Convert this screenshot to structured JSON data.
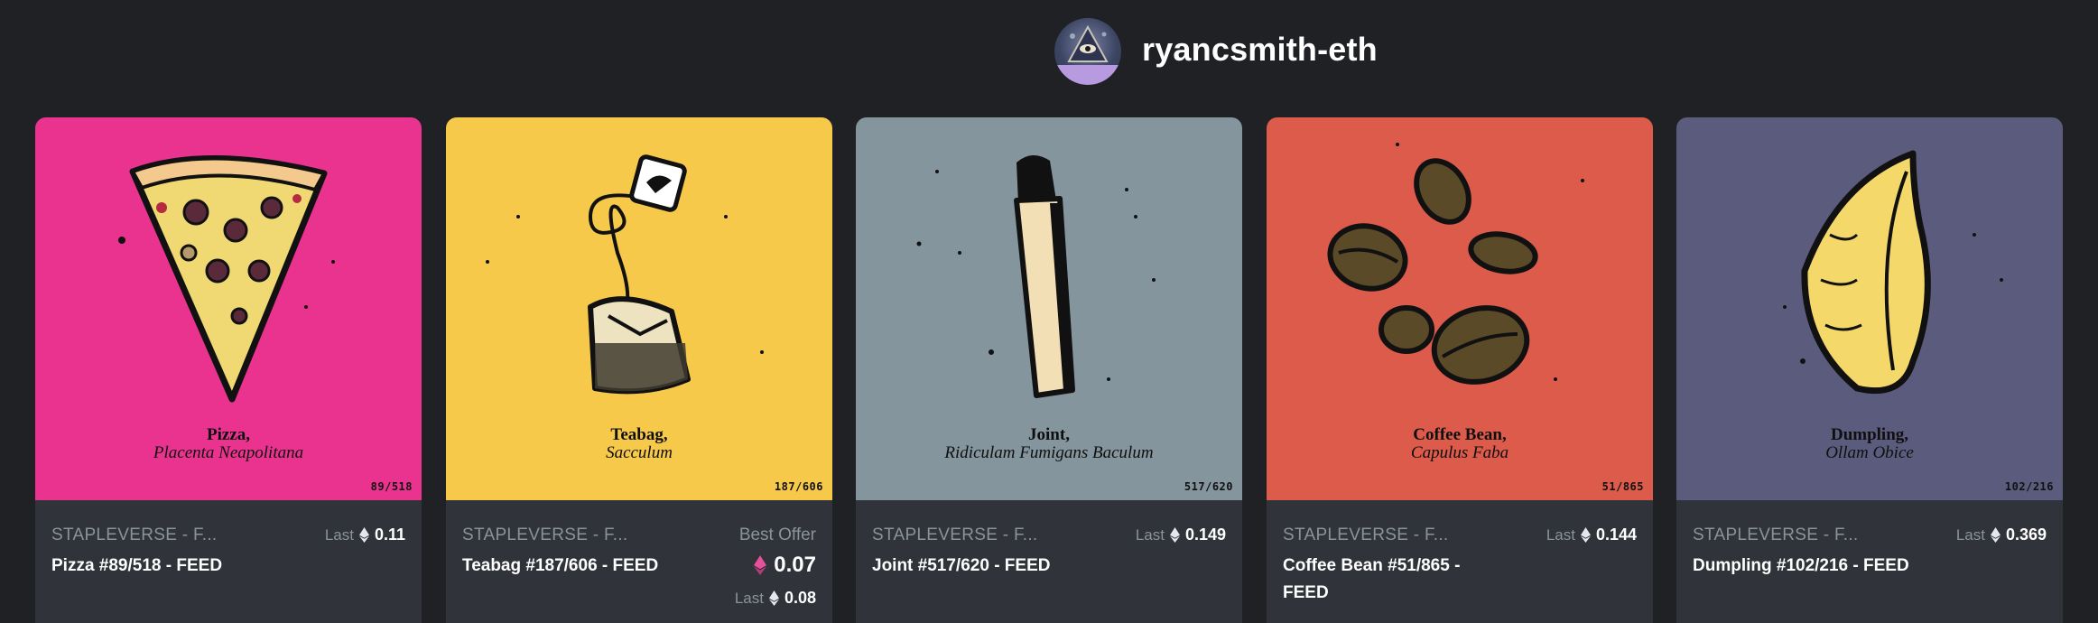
{
  "profile": {
    "username": "ryancsmith-eth"
  },
  "colors": {
    "background": "#202125",
    "card": "#303339",
    "muted": "#8a939b",
    "weth": "#e8509a"
  },
  "cards": [
    {
      "bg": "#e9338f",
      "art_name": "Pizza,",
      "art_latin": "Placenta Neapolitana",
      "edition": "89/518",
      "collection": "STAPLEVERSE - F...",
      "name": "Pizza #89/518 - FEED",
      "price_label": "Last",
      "price": "0.11",
      "icon": "eth-icon"
    },
    {
      "bg": "#f6c94a",
      "art_name": "Teabag,",
      "art_latin": "Sacculum",
      "edition": "187/606",
      "collection": "STAPLEVERSE - F...",
      "name": "Teabag #187/606 - FEED",
      "offer_label": "Best Offer",
      "offer": "0.07",
      "offer_icon": "weth-icon",
      "last_label": "Last",
      "last": "0.08",
      "icon": "eth-icon"
    },
    {
      "bg": "#84959d",
      "art_name": "Joint,",
      "art_latin": "Ridiculam Fumigans Baculum",
      "edition": "517/620",
      "collection": "STAPLEVERSE - F...",
      "name": "Joint #517/620 - FEED",
      "price_label": "Last",
      "price": "0.149",
      "icon": "eth-icon"
    },
    {
      "bg": "#dc5b4a",
      "art_name": "Coffee Bean,",
      "art_latin": "Capulus Faba",
      "edition": "51/865",
      "collection": "STAPLEVERSE - F...",
      "name": "Coffee Bean #51/865 - FEED",
      "price_label": "Last",
      "price": "0.144",
      "icon": "eth-icon"
    },
    {
      "bg": "#5b5c7d",
      "art_name": "Dumpling,",
      "art_latin": "Ollam Obice",
      "edition": "102/216",
      "collection": "STAPLEVERSE - F...",
      "name": "Dumpling #102/216 - FEED",
      "price_label": "Last",
      "price": "0.369",
      "icon": "eth-icon"
    }
  ]
}
